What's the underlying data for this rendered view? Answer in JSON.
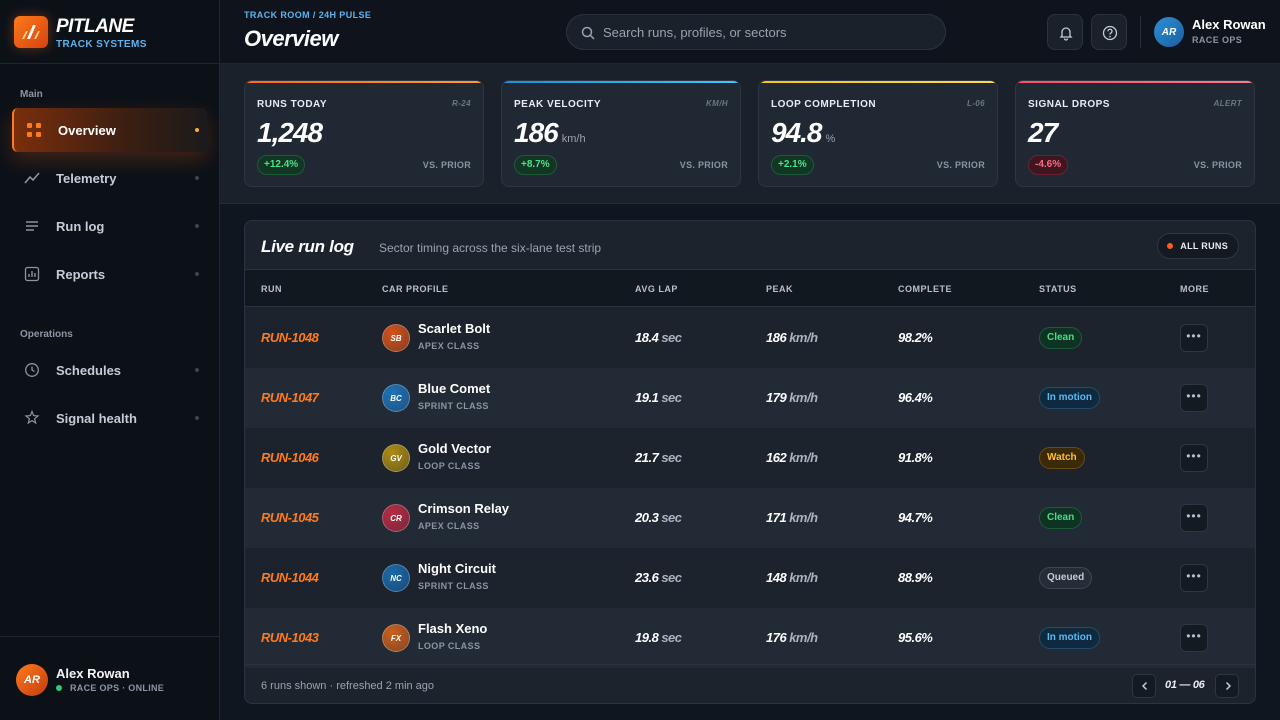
{
  "brand": {
    "name": "PITLANE",
    "sub": "TRACK SYSTEMS"
  },
  "sidebar": {
    "sections": [
      {
        "title": "Main",
        "items": [
          {
            "label": "Overview",
            "icon": "grid-icon",
            "active": true
          },
          {
            "label": "Telemetry",
            "icon": "chart-line-icon"
          },
          {
            "label": "Run log",
            "icon": "list-icon"
          },
          {
            "label": "Reports",
            "icon": "report-icon"
          }
        ]
      },
      {
        "title": "Operations",
        "items": [
          {
            "label": "Schedules",
            "icon": "clock-icon"
          },
          {
            "label": "Signal health",
            "icon": "signal-icon"
          }
        ]
      }
    ],
    "user": {
      "initials": "AR",
      "name": "Alex Rowan",
      "status": "RACE OPS · ONLINE"
    }
  },
  "header": {
    "breadcrumb": "TRACK ROOM / 24H PULSE",
    "title": "Overview",
    "search_placeholder": "Search runs, profiles, or sectors",
    "user": {
      "initials": "AR",
      "name": "Alex Rowan",
      "role": "RACE OPS"
    }
  },
  "stats": [
    {
      "label": "RUNS TODAY",
      "tag": "R-24",
      "value": "1,248",
      "unit": "",
      "delta": "+12.4%",
      "trend": "up",
      "compare": "VS. PRIOR",
      "color": "#ff6a1a"
    },
    {
      "label": "PEAK VELOCITY",
      "tag": "KM/H",
      "value": "186",
      "unit": "km/h",
      "delta": "+8.7%",
      "trend": "up",
      "compare": "VS. PRIOR",
      "color": "#2ba8f0"
    },
    {
      "label": "LOOP COMPLETION",
      "tag": "L-06",
      "value": "94.8",
      "unit": "%",
      "delta": "+2.1%",
      "trend": "up",
      "compare": "VS. PRIOR",
      "color": "#f5c518"
    },
    {
      "label": "SIGNAL DROPS",
      "tag": "ALERT",
      "value": "27",
      "unit": "",
      "delta": "-4.6%",
      "trend": "down",
      "compare": "VS. PRIOR",
      "color": "#ff4d6a"
    }
  ],
  "runlog": {
    "title": "Live run log",
    "subtitle": "Sector timing across the six-lane test strip",
    "filter": "ALL RUNS",
    "columns": [
      "RUN",
      "CAR PROFILE",
      "AVG LAP",
      "PEAK",
      "COMPLETE",
      "STATUS",
      "MORE"
    ],
    "rows": [
      {
        "id": "RUN-1048",
        "initials": "SB",
        "name": "Scarlet Bolt",
        "class": "APEX CLASS",
        "avg": "18.4",
        "avg_unit": "sec",
        "peak": "186",
        "peak_unit": "km/h",
        "complete": "98.2%",
        "status": "Clean",
        "status_kind": "clean",
        "avatar_color": "#e0561a"
      },
      {
        "id": "RUN-1047",
        "initials": "BC",
        "name": "Blue Comet",
        "class": "SPRINT CLASS",
        "avg": "19.1",
        "avg_unit": "sec",
        "peak": "179",
        "peak_unit": "km/h",
        "complete": "96.4%",
        "status": "In motion",
        "status_kind": "motion",
        "avatar_color": "#1e78c2"
      },
      {
        "id": "RUN-1046",
        "initials": "GV",
        "name": "Gold Vector",
        "class": "LOOP CLASS",
        "avg": "21.7",
        "avg_unit": "sec",
        "peak": "162",
        "peak_unit": "km/h",
        "complete": "91.8%",
        "status": "Watch",
        "status_kind": "watch",
        "avatar_color": "#b89412"
      },
      {
        "id": "RUN-1045",
        "initials": "CR",
        "name": "Crimson Relay",
        "class": "APEX CLASS",
        "avg": "20.3",
        "avg_unit": "sec",
        "peak": "171",
        "peak_unit": "km/h",
        "complete": "94.7%",
        "status": "Clean",
        "status_kind": "clean",
        "avatar_color": "#c22a45"
      },
      {
        "id": "RUN-1044",
        "initials": "NC",
        "name": "Night Circuit",
        "class": "SPRINT CLASS",
        "avg": "23.6",
        "avg_unit": "sec",
        "peak": "148",
        "peak_unit": "km/h",
        "complete": "88.9%",
        "status": "Queued",
        "status_kind": "queued",
        "avatar_color": "#1a6fb5"
      },
      {
        "id": "RUN-1043",
        "initials": "FX",
        "name": "Flash Xeno",
        "class": "LOOP CLASS",
        "avg": "19.8",
        "avg_unit": "sec",
        "peak": "176",
        "peak_unit": "km/h",
        "complete": "95.6%",
        "status": "In motion",
        "status_kind": "motion",
        "avatar_color": "#d9631a"
      }
    ],
    "footer": "6 runs shown · refreshed 2 min ago",
    "page_range": "01 — 06"
  }
}
